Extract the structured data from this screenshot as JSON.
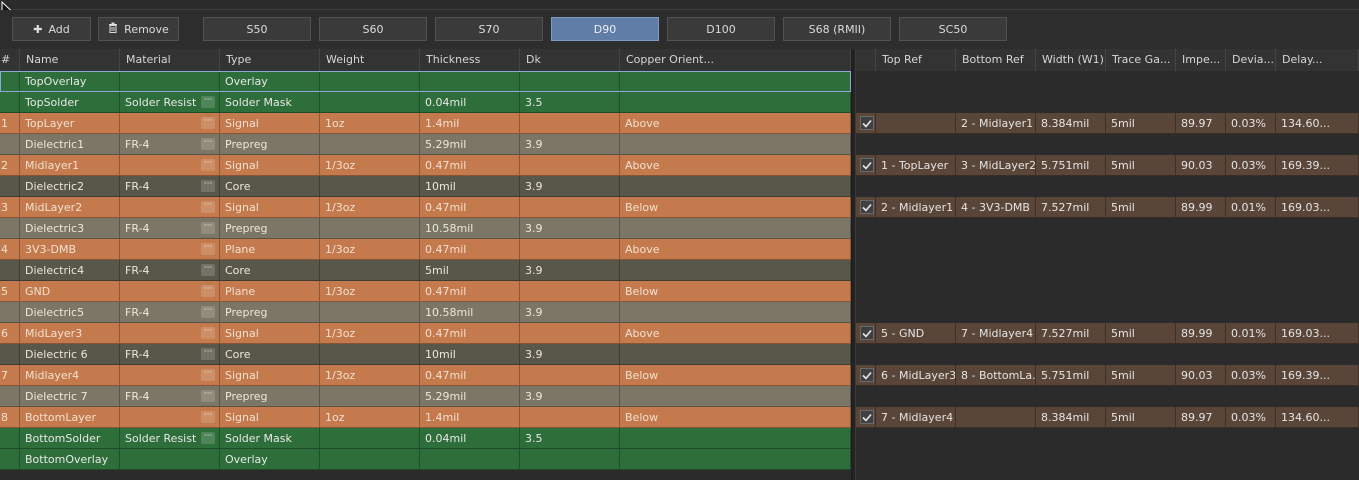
{
  "toolbar": {
    "add_label": "Add",
    "remove_label": "Remove",
    "impedance_profiles": [
      "S50",
      "S60",
      "S70",
      "D90",
      "D100",
      "S68 (RMII)",
      "SC50"
    ],
    "selected_profile": "D90"
  },
  "colors": {
    "signal_plane": "#c47a4c",
    "prepreg": "#7c7666",
    "core": "#595749",
    "overlay_solder": "#2e6e3a",
    "selected_button": "#5f7da6",
    "impedance_row": "#5a4638"
  },
  "stack_headers": [
    "#",
    "Name",
    "Material",
    "Type",
    "Weight",
    "Thickness",
    "Dk",
    "Copper Orient..."
  ],
  "stack_rows": [
    {
      "num": "",
      "name": "TopOverlay",
      "material": "",
      "type": "Overlay",
      "weight": "",
      "thickness": "",
      "dk": "",
      "orient": "",
      "kind": "overlay",
      "has_mat_btn": false
    },
    {
      "num": "",
      "name": "TopSolder",
      "material": "Solder Resist",
      "type": "Solder Mask",
      "weight": "",
      "thickness": "0.04mil",
      "dk": "3.5",
      "orient": "",
      "kind": "solder",
      "has_mat_btn": true
    },
    {
      "num": "1",
      "name": "TopLayer",
      "material": "",
      "type": "Signal",
      "weight": "1oz",
      "thickness": "1.4mil",
      "dk": "",
      "orient": "Above",
      "kind": "signal",
      "has_mat_btn": true
    },
    {
      "num": "",
      "name": "Dielectric1",
      "material": "FR-4",
      "type": "Prepreg",
      "weight": "",
      "thickness": "5.29mil",
      "dk": "3.9",
      "orient": "",
      "kind": "prepreg",
      "has_mat_btn": true
    },
    {
      "num": "2",
      "name": "Midlayer1",
      "material": "",
      "type": "Signal",
      "weight": "1/3oz",
      "thickness": "0.47mil",
      "dk": "",
      "orient": "Above",
      "kind": "signal",
      "has_mat_btn": true
    },
    {
      "num": "",
      "name": "Dielectric2",
      "material": "FR-4",
      "type": "Core",
      "weight": "",
      "thickness": "10mil",
      "dk": "3.9",
      "orient": "",
      "kind": "core",
      "has_mat_btn": true
    },
    {
      "num": "3",
      "name": "MidLayer2",
      "material": "",
      "type": "Signal",
      "weight": "1/3oz",
      "thickness": "0.47mil",
      "dk": "",
      "orient": "Below",
      "kind": "signal",
      "has_mat_btn": true
    },
    {
      "num": "",
      "name": "Dielectric3",
      "material": "FR-4",
      "type": "Prepreg",
      "weight": "",
      "thickness": "10.58mil",
      "dk": "3.9",
      "orient": "",
      "kind": "prepreg",
      "has_mat_btn": true
    },
    {
      "num": "4",
      "name": "3V3-DMB",
      "material": "",
      "type": "Plane",
      "weight": "1/3oz",
      "thickness": "0.47mil",
      "dk": "",
      "orient": "Above",
      "kind": "plane",
      "has_mat_btn": true
    },
    {
      "num": "",
      "name": "Dielectric4",
      "material": "FR-4",
      "type": "Core",
      "weight": "",
      "thickness": "5mil",
      "dk": "3.9",
      "orient": "",
      "kind": "core",
      "has_mat_btn": true
    },
    {
      "num": "5",
      "name": "GND",
      "material": "",
      "type": "Plane",
      "weight": "1/3oz",
      "thickness": "0.47mil",
      "dk": "",
      "orient": "Below",
      "kind": "plane",
      "has_mat_btn": true
    },
    {
      "num": "",
      "name": "Dielectric5",
      "material": "FR-4",
      "type": "Prepreg",
      "weight": "",
      "thickness": "10.58mil",
      "dk": "3.9",
      "orient": "",
      "kind": "prepreg",
      "has_mat_btn": true
    },
    {
      "num": "6",
      "name": "MidLayer3",
      "material": "",
      "type": "Signal",
      "weight": "1/3oz",
      "thickness": "0.47mil",
      "dk": "",
      "orient": "Above",
      "kind": "signal",
      "has_mat_btn": true
    },
    {
      "num": "",
      "name": "Dielectric 6",
      "material": "FR-4",
      "type": "Core",
      "weight": "",
      "thickness": "10mil",
      "dk": "3.9",
      "orient": "",
      "kind": "core",
      "has_mat_btn": true
    },
    {
      "num": "7",
      "name": "Midlayer4",
      "material": "",
      "type": "Signal",
      "weight": "1/3oz",
      "thickness": "0.47mil",
      "dk": "",
      "orient": "Below",
      "kind": "signal",
      "has_mat_btn": true
    },
    {
      "num": "",
      "name": "Dielectric 7",
      "material": "FR-4",
      "type": "Prepreg",
      "weight": "",
      "thickness": "5.29mil",
      "dk": "3.9",
      "orient": "",
      "kind": "prepreg",
      "has_mat_btn": true
    },
    {
      "num": "8",
      "name": "BottomLayer",
      "material": "",
      "type": "Signal",
      "weight": "1oz",
      "thickness": "1.4mil",
      "dk": "",
      "orient": "Below",
      "kind": "signal",
      "has_mat_btn": true
    },
    {
      "num": "",
      "name": "BottomSolder",
      "material": "Solder Resist",
      "type": "Solder Mask",
      "weight": "",
      "thickness": "0.04mil",
      "dk": "3.5",
      "orient": "",
      "kind": "solder",
      "has_mat_btn": true
    },
    {
      "num": "",
      "name": "BottomOverlay",
      "material": "",
      "type": "Overlay",
      "weight": "",
      "thickness": "",
      "dk": "",
      "orient": "",
      "kind": "overlay",
      "has_mat_btn": false
    }
  ],
  "impedance_headers": [
    "",
    "Top Ref",
    "Bottom Ref",
    "Width (W1)",
    "Trace Ga...",
    "Impe...",
    "Devia...",
    "Delay..."
  ],
  "impedance_rows": [
    null,
    null,
    {
      "checked": true,
      "top_ref": "",
      "bottom_ref": "2 - Midlayer1",
      "width": "8.384mil",
      "gap": "5mil",
      "imp": "89.97",
      "dev": "0.03%",
      "delay": "134.60..."
    },
    null,
    {
      "checked": true,
      "top_ref": "1 - TopLayer",
      "bottom_ref": "3 - MidLayer2",
      "width": "5.751mil",
      "gap": "5mil",
      "imp": "90.03",
      "dev": "0.03%",
      "delay": "169.39..."
    },
    null,
    {
      "checked": true,
      "top_ref": "2 - Midlayer1",
      "bottom_ref": "4 - 3V3-DMB",
      "width": "7.527mil",
      "gap": "5mil",
      "imp": "89.99",
      "dev": "0.01%",
      "delay": "169.03..."
    },
    null,
    null,
    null,
    null,
    null,
    {
      "checked": true,
      "top_ref": "5 - GND",
      "bottom_ref": "7 - Midlayer4",
      "width": "7.527mil",
      "gap": "5mil",
      "imp": "89.99",
      "dev": "0.01%",
      "delay": "169.03..."
    },
    null,
    {
      "checked": true,
      "top_ref": "6 - MidLayer3",
      "bottom_ref": "8 - BottomLa...",
      "width": "5.751mil",
      "gap": "5mil",
      "imp": "90.03",
      "dev": "0.03%",
      "delay": "169.39..."
    },
    null,
    {
      "checked": true,
      "top_ref": "7 - Midlayer4",
      "bottom_ref": "",
      "width": "8.384mil",
      "gap": "5mil",
      "imp": "89.97",
      "dev": "0.03%",
      "delay": "134.60..."
    },
    null,
    null
  ]
}
